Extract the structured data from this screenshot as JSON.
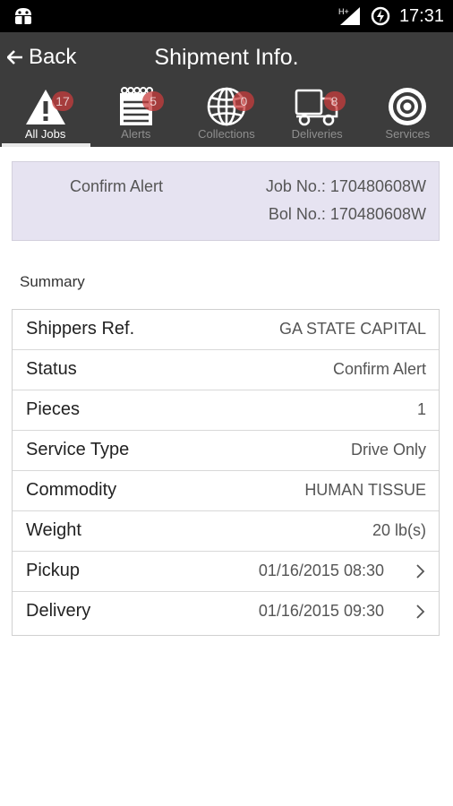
{
  "status_bar": {
    "time": "17:31",
    "icons": [
      "android-icon",
      "signal-icon",
      "data-saver-icon"
    ]
  },
  "app_bar": {
    "back_label": "Back",
    "title": "Shipment Info."
  },
  "tabs": [
    {
      "label": "All Jobs",
      "badge": "17",
      "icon": "warning-icon",
      "active": true
    },
    {
      "label": "Alerts",
      "badge": "5",
      "icon": "notepad-icon",
      "active": false
    },
    {
      "label": "Collections",
      "badge": "0",
      "icon": "globe-icon",
      "active": false
    },
    {
      "label": "Deliveries",
      "badge": "8",
      "icon": "truck-icon",
      "active": false
    },
    {
      "label": "Services",
      "badge": "",
      "icon": "target-icon",
      "active": false
    }
  ],
  "info": {
    "alert": "Confirm Alert",
    "job": "Job No.: 170480608W",
    "bol": "Bol No.: 170480608W",
    "bg_color": "#e6e3f1"
  },
  "summary": {
    "heading": "Summary",
    "rows": [
      {
        "label": "Shippers Ref.",
        "value": "GA STATE CAPITAL"
      },
      {
        "label": "Status",
        "value": "Confirm Alert"
      },
      {
        "label": "Pieces",
        "value": "1"
      },
      {
        "label": "Service Type",
        "value": "Drive Only"
      },
      {
        "label": "Commodity",
        "value": "HUMAN TISSUE"
      },
      {
        "label": "Weight",
        "value": "20 lb(s)"
      },
      {
        "label": "Pickup",
        "value": "01/16/2015 08:30"
      },
      {
        "label": "Delivery",
        "value": "01/16/2015 09:30"
      }
    ]
  }
}
